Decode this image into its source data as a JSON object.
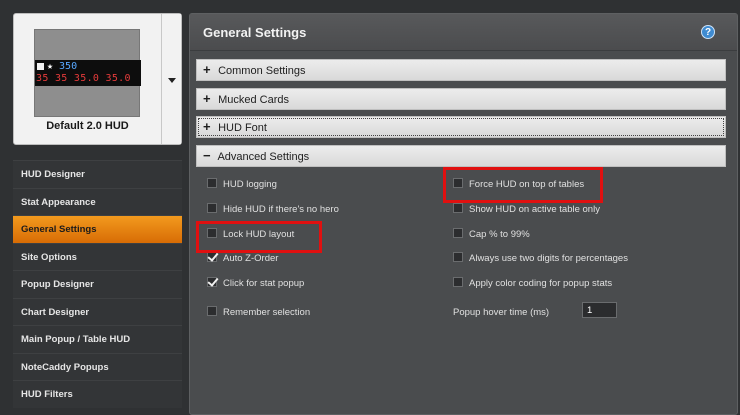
{
  "hud_preview": {
    "row1_star": "★",
    "row1_value": "350",
    "row2": "35 35 35.0 35.0",
    "name": "Default 2.0 HUD"
  },
  "nav": {
    "items": [
      {
        "label": "HUD Designer"
      },
      {
        "label": "Stat Appearance"
      },
      {
        "label": "General Settings",
        "active": true
      },
      {
        "label": "Site Options"
      },
      {
        "label": "Popup Designer"
      },
      {
        "label": "Chart Designer"
      },
      {
        "label": "Main Popup / Table HUD"
      },
      {
        "label": "NoteCaddy Popups"
      },
      {
        "label": "HUD Filters"
      }
    ]
  },
  "main": {
    "title": "General Settings",
    "help_icon": "?",
    "sections": [
      {
        "sign": "+",
        "label": "Common Settings"
      },
      {
        "sign": "+",
        "label": "Mucked Cards"
      },
      {
        "sign": "+",
        "label": "HUD Font"
      },
      {
        "sign": "−",
        "label": "Advanced Settings"
      }
    ],
    "left_options": [
      {
        "label": "HUD logging",
        "checked": false
      },
      {
        "label": "Hide HUD if there's no hero",
        "checked": false
      },
      {
        "label": "Lock HUD layout",
        "checked": false
      },
      {
        "label": "Auto Z-Order",
        "checked": true
      },
      {
        "label": "Click for stat popup",
        "checked": true
      },
      {
        "label": "Remember selection",
        "checked": false
      }
    ],
    "right_options": [
      {
        "label": "Force HUD on top of tables",
        "checked": false
      },
      {
        "label": "Show HUD on active table only",
        "checked": false
      },
      {
        "label": "Cap % to 99%",
        "checked": false
      },
      {
        "label": "Always use two digits for percentages",
        "checked": false
      },
      {
        "label": "Apply color coding for popup stats",
        "checked": false
      }
    ],
    "popup_hover": {
      "label": "Popup hover time (ms)",
      "value": "1"
    }
  },
  "colors": {
    "accent_orange": "#e8820f",
    "highlight_red": "#e01010",
    "help_blue": "#3f8bd1"
  }
}
